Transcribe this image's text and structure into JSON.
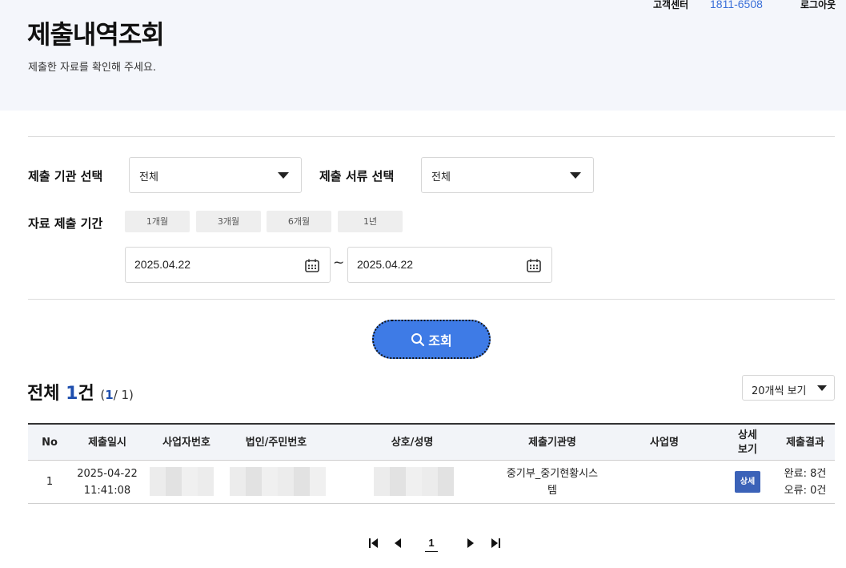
{
  "header": {
    "customer_center_label": "고객센터",
    "customer_center_phone": "1811-6508",
    "logout_label": "로그아웃",
    "title": "제출내역조회",
    "subtitle": "제출한 자료를 확인해 주세요."
  },
  "filters": {
    "org_label": "제출 기관 선택",
    "org_value": "전체",
    "doc_label": "제출 서류 선택",
    "doc_value": "전체",
    "period_label": "자료 제출 기간",
    "period_buttons": [
      "1개월",
      "3개월",
      "6개월",
      "1년"
    ],
    "date_from": "2025.04.22",
    "date_separator": "~",
    "date_to": "2025.04.22",
    "search_label": "조회"
  },
  "summary": {
    "total_prefix": "전체",
    "total_count": "1",
    "total_suffix": "건",
    "page_open": "(",
    "page_current": "1",
    "page_rest": "/ 1)",
    "per_page_value": "20개씩 보기"
  },
  "table": {
    "headers": {
      "no": "No",
      "date": "제출일시",
      "biz_no": "사업자번호",
      "corp_no": "법인/주민번호",
      "name": "상호/성명",
      "org": "제출기관명",
      "project": "사업명",
      "detail_line1": "상세",
      "detail_line2": "보기",
      "result": "제출결과"
    },
    "rows": [
      {
        "no": "1",
        "date_line1": "2025-04-22",
        "date_line2": "11:41:08",
        "org_line1": "중기부_중기현황시스",
        "org_line2": "템",
        "project": "",
        "detail_badge": "상세",
        "result_line1": "완료: 8건",
        "result_line2": "오류: 0건"
      }
    ]
  },
  "pagination": {
    "current_page": "1"
  },
  "colors": {
    "accent_blue": "#3e7be6",
    "phone_blue": "#3a6fd8",
    "count_blue": "#1f4fae",
    "badge_blue": "#3b62b8",
    "header_band": "#f4f6fb"
  }
}
